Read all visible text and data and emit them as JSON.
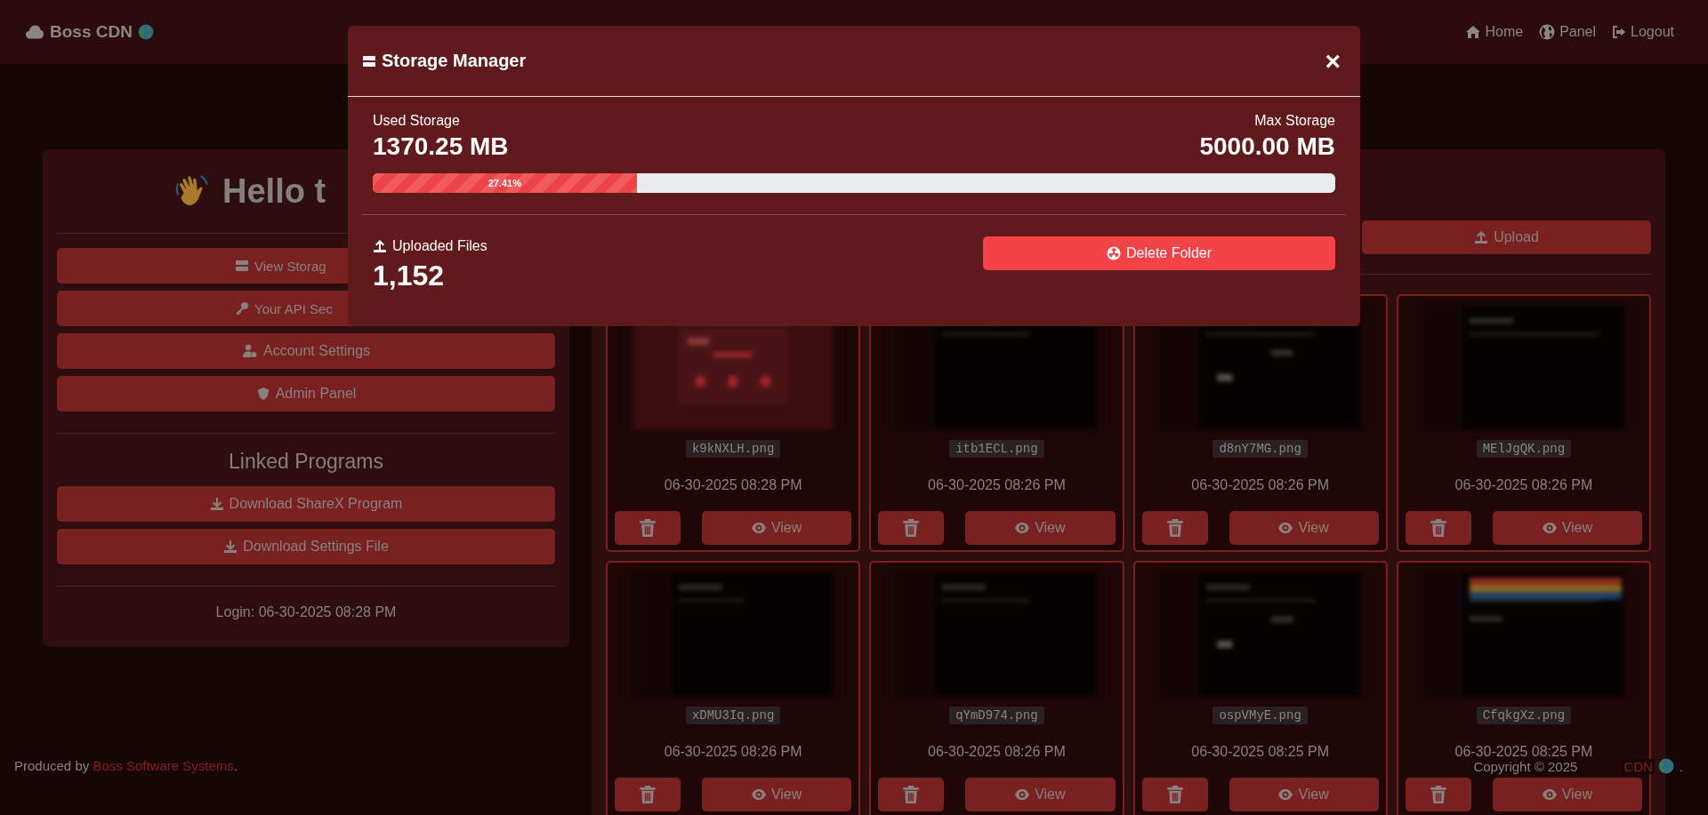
{
  "navbar": {
    "brand": "Boss CDN",
    "links": [
      "Home",
      "Panel",
      "Logout"
    ]
  },
  "sidebar": {
    "greeting": "Hello t",
    "actions": [
      "View Storag",
      "Your API Sec",
      "Account Settings",
      "Admin Panel"
    ],
    "programs_title": "Linked Programs",
    "downloads": [
      "Download ShareX Program",
      "Download Settings File"
    ],
    "login": "Login: 06-30-2025 08:28 PM"
  },
  "files": {
    "upload_button": "Upload",
    "cards": [
      {
        "filename": "k9kNXLH.png",
        "date": "06-30-2025 08:28 PM",
        "view": "View"
      },
      {
        "filename": "itb1ECL.png",
        "date": "06-30-2025 08:26 PM",
        "view": "View"
      },
      {
        "filename": "d8nY7MG.png",
        "date": "06-30-2025 08:26 PM",
        "view": "View"
      },
      {
        "filename": "MElJgQK.png",
        "date": "06-30-2025 08:26 PM",
        "view": "View"
      },
      {
        "filename": "xDMU3Iq.png",
        "date": "06-30-2025 08:26 PM",
        "view": "View"
      },
      {
        "filename": "qYmD974.png",
        "date": "06-30-2025 08:26 PM",
        "view": "View"
      },
      {
        "filename": "ospVMyE.png",
        "date": "06-30-2025 08:25 PM",
        "view": "View"
      },
      {
        "filename": "CfqkgXz.png",
        "date": "06-30-2025 08:25 PM",
        "view": "View"
      }
    ]
  },
  "footer": {
    "produced": "Produced by",
    "produced_link": "Boss Software Systems",
    "produced_end": ".",
    "copyright": "Copyright © 2025",
    "copyright_link": "CDN",
    "copyright_end": "."
  },
  "modal": {
    "title": "Storage Manager",
    "close": "×",
    "used_label": "Used Storage",
    "used_value": "1370.25 MB",
    "max_label": "Max Storage",
    "max_value": "5000.00 MB",
    "usage": {
      "level": 0.2741,
      "reading": "27.41%"
    },
    "files_label": "Uploaded Files",
    "files_count": "1,152",
    "delete_button": "Delete Folder"
  }
}
